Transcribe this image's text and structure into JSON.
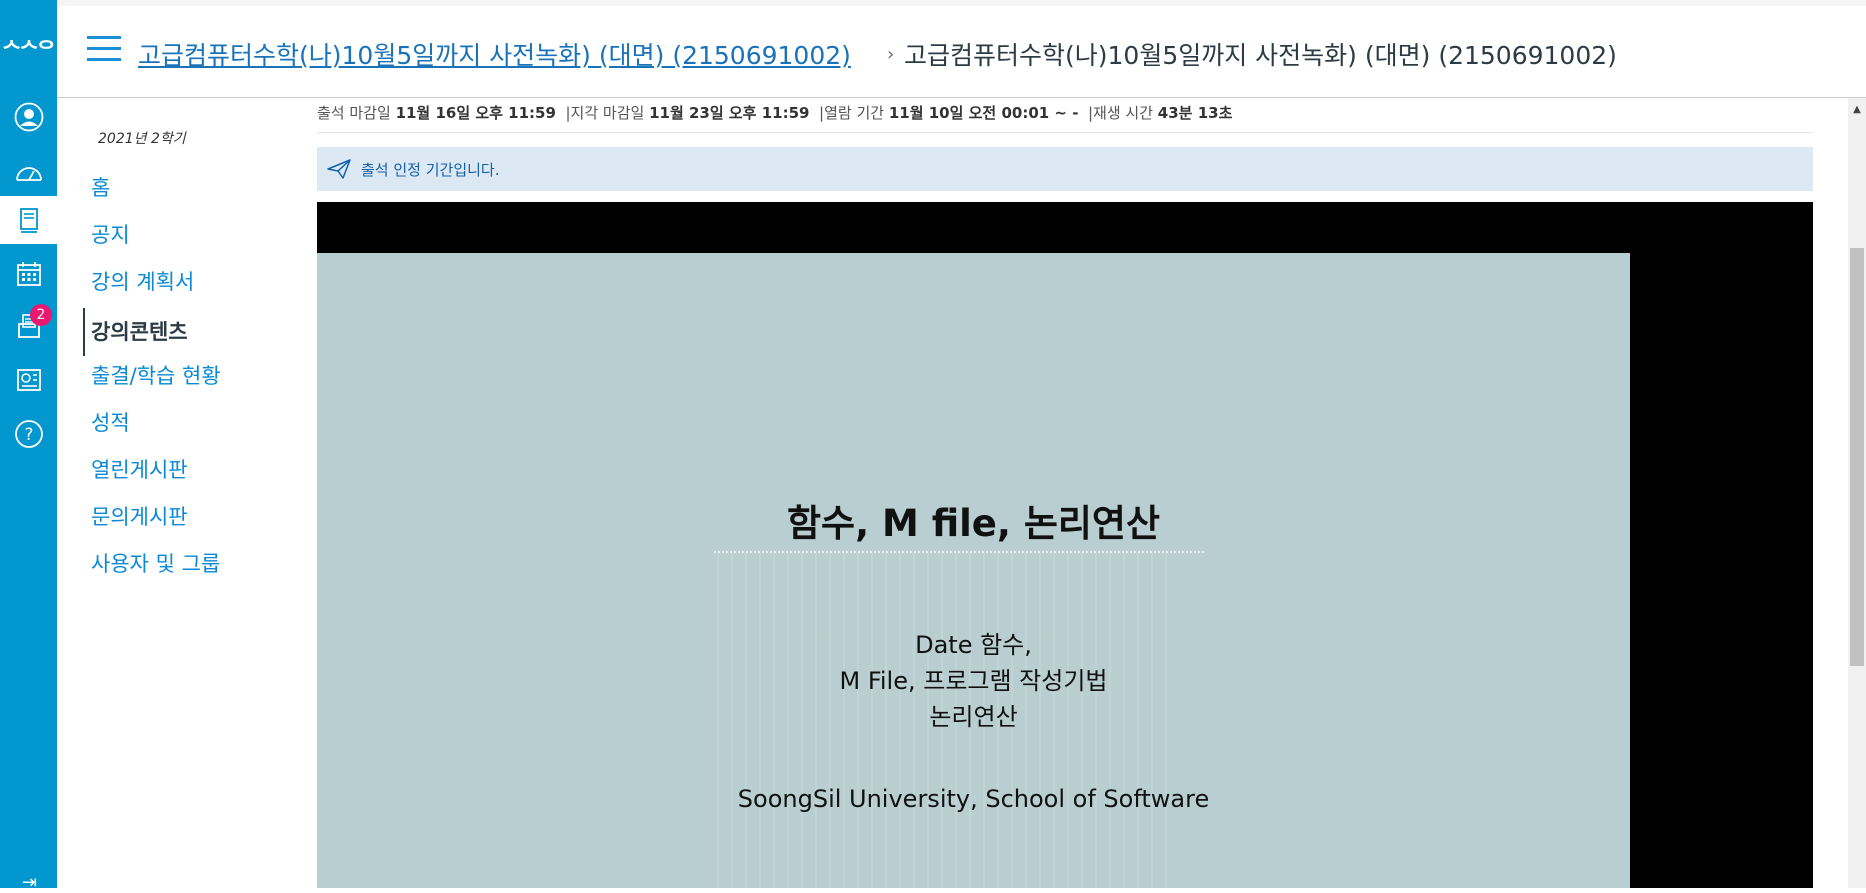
{
  "global_nav": {
    "logo_text": "ᄉᄉᄋ",
    "items": [
      {
        "name": "account",
        "icon": "account-icon"
      },
      {
        "name": "dashboard",
        "icon": "dashboard-icon"
      },
      {
        "name": "courses",
        "icon": "courses-icon",
        "active": true
      },
      {
        "name": "calendar",
        "icon": "calendar-icon"
      },
      {
        "name": "inbox",
        "icon": "inbox-icon",
        "badge": "2"
      },
      {
        "name": "commons",
        "icon": "commons-icon"
      },
      {
        "name": "help",
        "icon": "help-icon"
      }
    ],
    "collapse_glyph": "⇥"
  },
  "header": {
    "course_link": "고급컴퓨터수학(나)10월5일까지 사전녹화) (대면) (2150691002)",
    "separator": "›",
    "current_page": "고급컴퓨터수학(나)10월5일까지 사전녹화) (대면) (2150691002)"
  },
  "course_nav": {
    "term": "2021년 2학기",
    "items": [
      {
        "label": "홈"
      },
      {
        "label": "공지"
      },
      {
        "label": "강의 계획서"
      },
      {
        "label": "강의콘텐츠",
        "active": true
      },
      {
        "label": "출결/학습 현황"
      },
      {
        "label": "성적"
      },
      {
        "label": "열린게시판"
      },
      {
        "label": "문의게시판"
      },
      {
        "label": "사용자 및 그룹"
      }
    ]
  },
  "content": {
    "meta": {
      "attend_deadline_label": "출석 마감일",
      "attend_deadline_value": "11월 16일 오후 11:59",
      "late_deadline_label": "|지각 마감일",
      "late_deadline_value": "11월 23일 오후 11:59",
      "open_period_label": "|열람 기간",
      "open_period_value": "11월 10일 오전 00:01 ~ -",
      "play_time_label": "|재생 시간",
      "play_time_value": "43분 13초"
    },
    "notice": "출석 인정 기간입니다.",
    "slide": {
      "title": "함수, M file, 논리연산",
      "lines": [
        "Date 함수,",
        "M File, 프로그램 작성기법",
        "논리연산"
      ],
      "footer": "SoongSil University, School of Software"
    }
  },
  "colors": {
    "nav_bg": "#0297cf",
    "link": "#0a8ad6",
    "badge": "#e8196e",
    "notice_bg": "#dce9f5",
    "slide_bg": "#b8ced1"
  }
}
